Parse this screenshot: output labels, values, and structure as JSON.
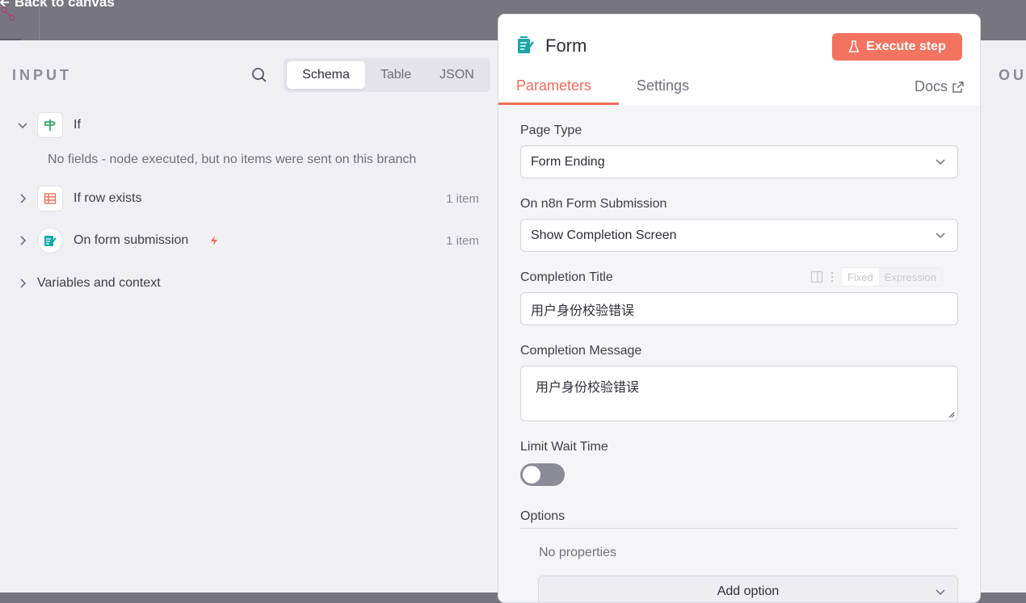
{
  "topbar": {
    "back_label": "Back to canvas"
  },
  "input": {
    "title": "INPUT",
    "view_tabs": [
      "Schema",
      "Table",
      "JSON"
    ],
    "nodes": [
      {
        "label": "If",
        "message": "No fields - node executed, but no items were sent on this branch"
      },
      {
        "label": "If row exists",
        "count": "1 item"
      },
      {
        "label": "On form submission",
        "count": "1 item"
      }
    ],
    "variables_label": "Variables and context"
  },
  "output": {
    "title": "OU"
  },
  "panel": {
    "title": "Form",
    "execute_label": "Execute step",
    "tabs": {
      "parameters": "Parameters",
      "settings": "Settings"
    },
    "docs_label": "Docs",
    "fields": {
      "page_type": {
        "label": "Page Type",
        "value": "Form Ending"
      },
      "on_submission": {
        "label": "On n8n Form Submission",
        "value": "Show Completion Screen"
      },
      "completion_title": {
        "label": "Completion Title",
        "value": "用户身份校验错误",
        "mode_fixed": "Fixed",
        "mode_expression": "Expression"
      },
      "completion_message": {
        "label": "Completion Message",
        "value": "用户身份校验错误"
      },
      "limit_wait": {
        "label": "Limit Wait Time"
      }
    },
    "options": {
      "title": "Options",
      "empty": "No properties",
      "add_label": "Add option"
    }
  },
  "colors": {
    "accent": "#ef6b57",
    "execute_bg": "#f2735f",
    "form_icon": "#1aa6a6",
    "if_icon": "#1a9a55",
    "table_icon": "#e8735e"
  }
}
